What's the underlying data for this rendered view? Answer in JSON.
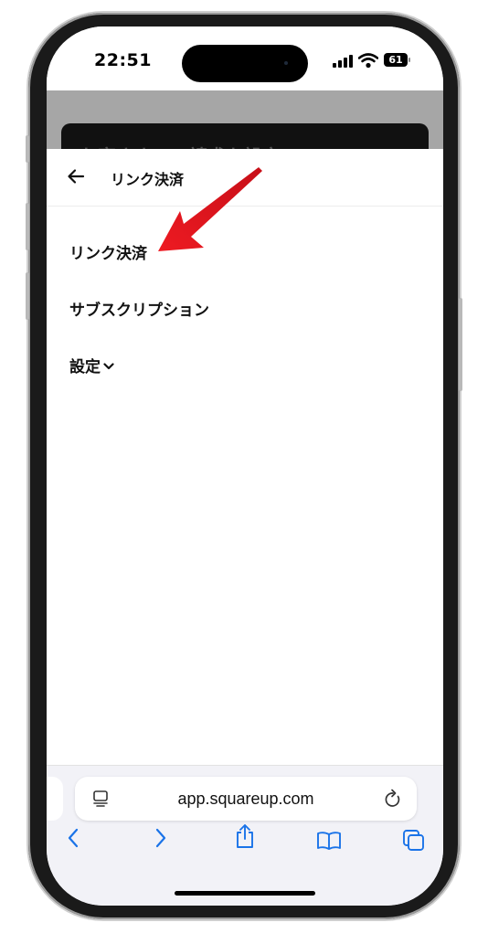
{
  "status_bar": {
    "time": "22:51",
    "battery": "61"
  },
  "background_page": {
    "partial_heading": "お客さまへの請求を設定"
  },
  "sheet": {
    "title": "リンク決済",
    "back_icon": "arrow-left-icon",
    "menu": [
      {
        "label": "リンク決済"
      },
      {
        "label": "サブスクリプション"
      },
      {
        "label": "設定"
      }
    ],
    "settings_chevron": "chevron-down-icon"
  },
  "browser": {
    "url": "app.squareup.com",
    "toolbar_icons": [
      "back-icon",
      "forward-icon",
      "share-icon",
      "bookmarks-icon",
      "tabs-icon"
    ]
  },
  "colors": {
    "annotation_arrow": "#e8141c",
    "link_blue": "#1a73e8"
  }
}
